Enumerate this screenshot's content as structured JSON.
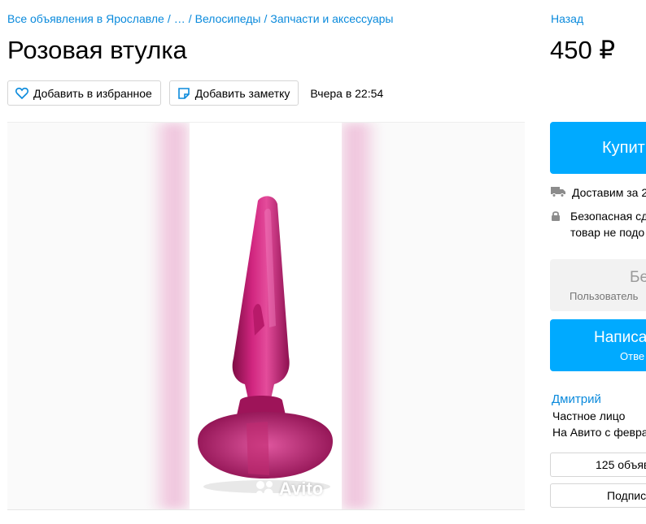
{
  "breadcrumb": {
    "items": [
      "Все объявления в Ярославле",
      "…",
      "Велосипеды",
      "Запчасти и аксессуары"
    ],
    "separator": "/"
  },
  "nav": {
    "back_label": "Назад"
  },
  "listing": {
    "title": "Розовая втулка",
    "price": "450 ₽",
    "favorite_label": "Добавить в избранное",
    "note_label": "Добавить заметку",
    "date": "Вчера в 22:54"
  },
  "gallery": {
    "watermark": "Avito"
  },
  "sidebar": {
    "buy_label": "Купит",
    "delivery_text": "Доставим за 2",
    "safe_line1": "Безопасная сд",
    "safe_line2": "товар не подо",
    "grey_box_big": "Бе",
    "grey_box_small": "Пользователь",
    "write_label": "Написа",
    "write_sub": "Отве",
    "seller_name": "Дмитрий",
    "seller_type": "Частное лицо",
    "seller_since": "На Авито с февра",
    "ads_count_label": "125 объяв",
    "subscribe_label": "Подпис"
  },
  "colors": {
    "accent": "#00aaff",
    "link": "#0a8adc",
    "product": "#c4156e"
  }
}
